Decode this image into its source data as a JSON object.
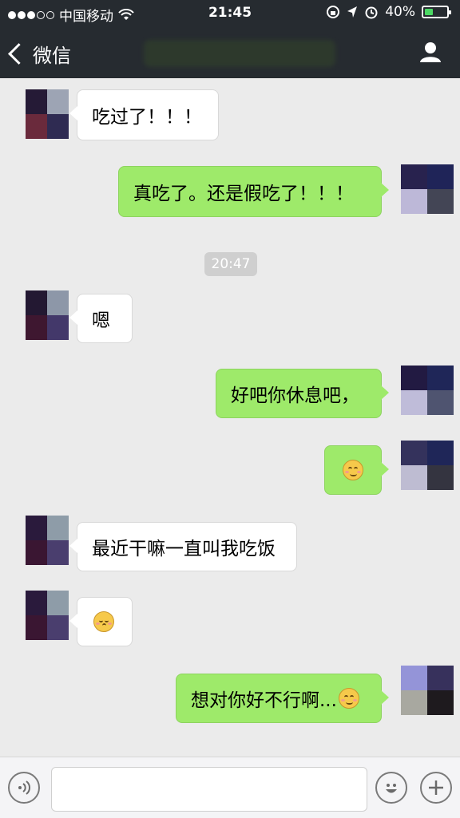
{
  "status_bar": {
    "carrier": "中国移动",
    "time": "21:45",
    "battery": "40%",
    "battery_fraction": 0.4
  },
  "nav": {
    "back_label": "微信"
  },
  "chat": {
    "messages": [
      {
        "side": "left",
        "text": "吃过了！！！"
      },
      {
        "side": "right",
        "text": "真吃了。还是假吃了！！！"
      },
      {
        "side": "left",
        "text": "嗯"
      },
      {
        "side": "right",
        "text": "好吧你休息吧，"
      },
      {
        "side": "right",
        "emoji": "smile-emoji"
      },
      {
        "side": "left",
        "text": "最近干嘛一直叫我吃饭"
      },
      {
        "side": "left",
        "emoji": "shy-emoji"
      },
      {
        "side": "right",
        "text": "想对你好不行啊...",
        "emoji": "smile-emoji"
      }
    ],
    "timestamp": "20:47"
  },
  "input": {
    "placeholder": ""
  },
  "colors": {
    "header": "#262b30",
    "right_bubble": "#9eea6a",
    "background": "#ebebeb"
  }
}
